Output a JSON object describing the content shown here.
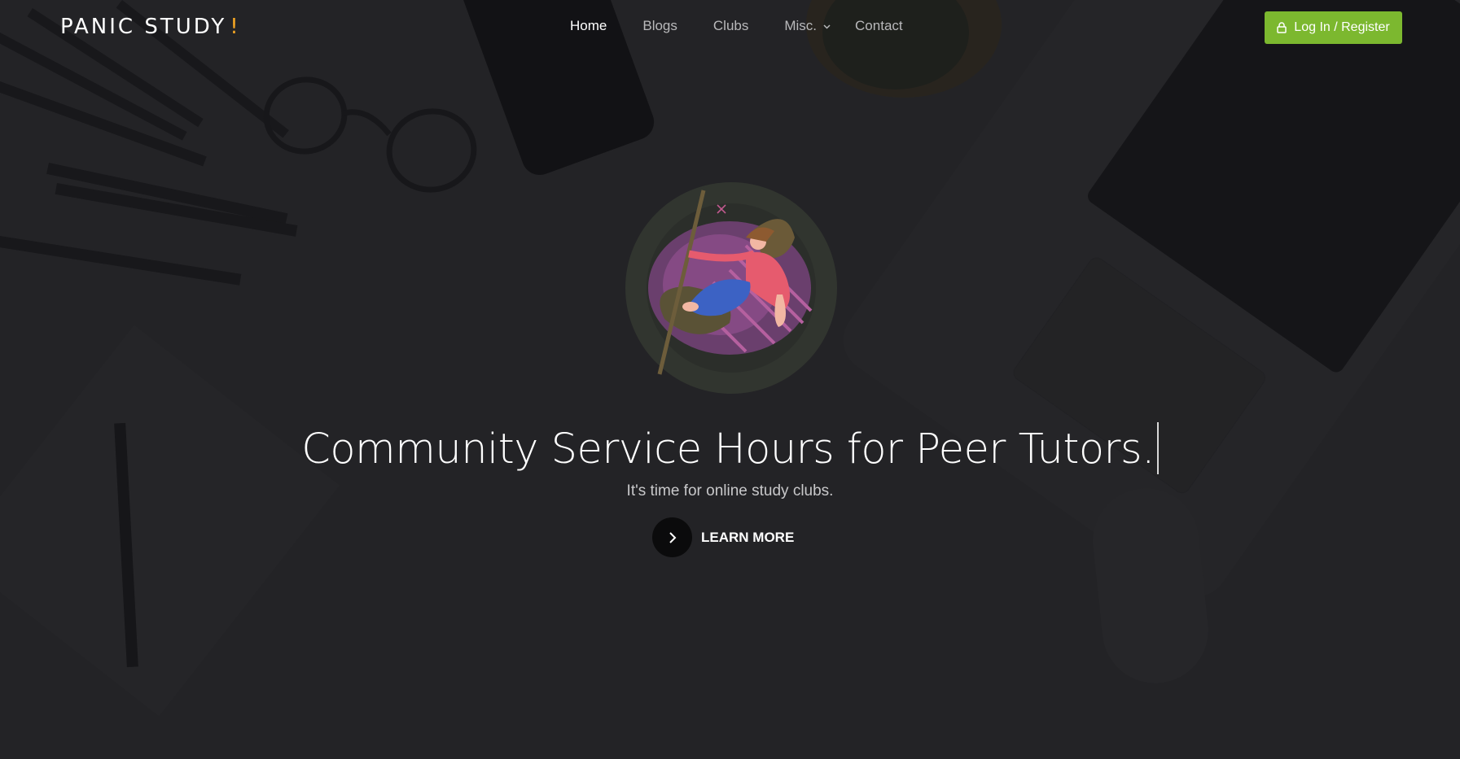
{
  "brand": {
    "name": "PANIC STUDY",
    "accent": "!"
  },
  "nav": {
    "items": [
      {
        "label": "Home",
        "active": true
      },
      {
        "label": "Blogs",
        "active": false
      },
      {
        "label": "Clubs",
        "active": false
      },
      {
        "label": "Misc.",
        "active": false,
        "dropdown": true
      },
      {
        "label": "Contact",
        "active": false
      }
    ],
    "login_label": "Log In / Register"
  },
  "hero": {
    "headline": "Community Service Hours for Peer Tutors.",
    "subtitle": "It's time for online study clubs.",
    "cta_label": "LEARN MORE"
  },
  "icons": {
    "login": "lock-icon",
    "cta": "chevron-right-icon",
    "dropdown": "chevron-down-icon"
  },
  "colors": {
    "brand_accent": "#f5a623",
    "login_button": "#7cb82f",
    "background": "#2a2a2c"
  }
}
